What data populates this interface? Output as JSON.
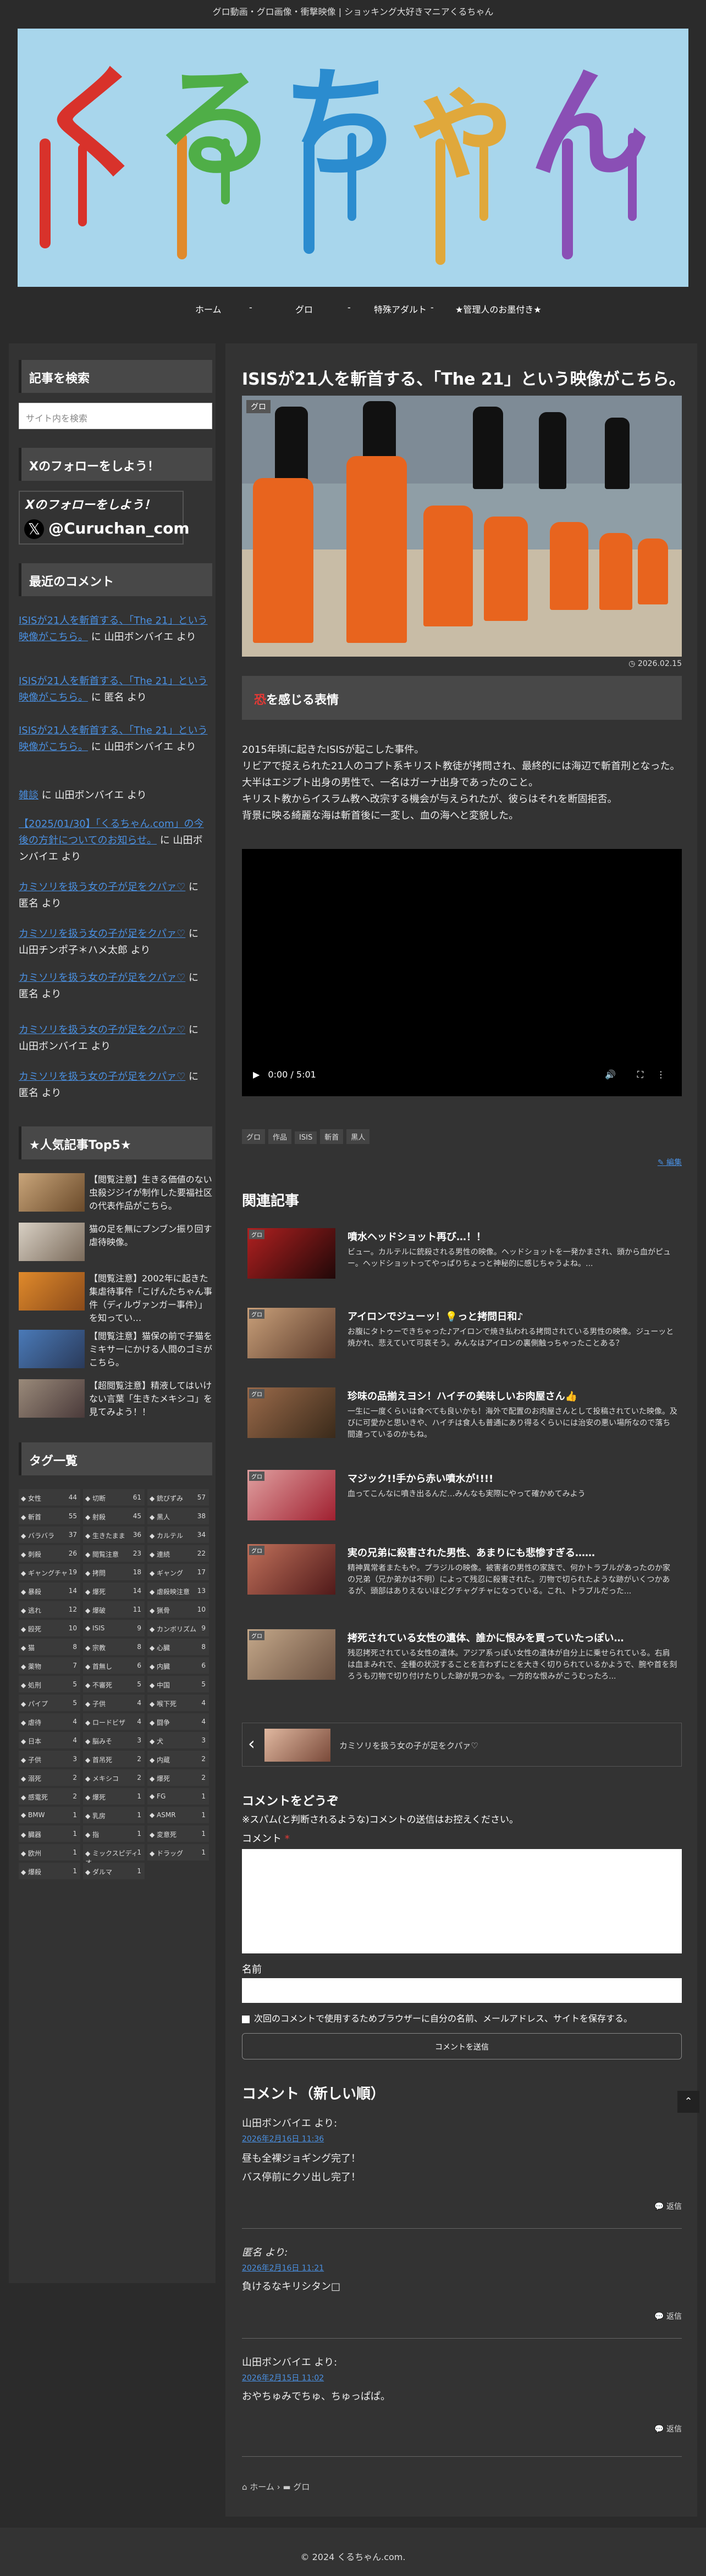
{
  "header": {
    "tagline": "グロ動画・グロ画像・衝撃映像 | ショッキング大好きマニアくるちゃん",
    "logo_text": "くるちゃん"
  },
  "nav": {
    "items": [
      "ホーム",
      "グロ",
      "特殊アダルト",
      "★管理人のお墨付き★"
    ],
    "separator": "-"
  },
  "sidebar": {
    "search_title": "記事を検索",
    "search_placeholder": "サイト内を検索",
    "follow_title": "Xのフォローをしよう！",
    "follow_banner_line1": "Xのフォローをしよう！",
    "follow_banner_handle": "@Curuchan_com",
    "recent_title": "最近のコメント",
    "recent_comments": [
      {
        "link": "ISISが21人を斬首する、「The 21」という映像がこちら。",
        "text": " に 山田ボンバイエ より"
      },
      {
        "link": "ISISが21人を斬首する、「The 21」という映像がこちら。",
        "text": " に 匿名 より"
      },
      {
        "link": "ISISが21人を斬首する、「The 21」という映像がこちら。",
        "text": " に 山田ボンバイエ より"
      },
      {
        "link": "雑談",
        "text": " に 山田ボンバイエ より"
      },
      {
        "link": "【2025/01/30】「くるちゃん.com」の今後の方針についてのお知らせ。",
        "text": " に 山田ボンバイエ より"
      },
      {
        "link": "カミソリを扱う女の子が足をクパァ♡",
        "text": " に 匿名 より"
      },
      {
        "link": "カミソリを扱う女の子が足をクパァ♡",
        "text": " に 山田チンポ子＊ハメ太郎 より"
      },
      {
        "link": "カミソリを扱う女の子が足をクパァ♡",
        "text": " に 匿名 より"
      },
      {
        "link": "カミソリを扱う女の子が足をクパァ♡",
        "text": " に 山田ボンバイエ より"
      },
      {
        "link": "カミソリを扱う女の子が足をクパァ♡",
        "text": " に 匿名 より"
      }
    ],
    "popular_title": "★人気記事Top5★",
    "popular": [
      "【閲覧注意】生きる価値のない虫殺ジジイが制作した要福社区の代表作品がこちら。",
      "猫の足を無にブンブン振り回す虐待映像。",
      "【閲覧注意】2002年に起きた集虐待事件「こげんたちゃん事件（ディルヴァンガー事件）」を知ってい…",
      "【閲覧注意】猫保の前で子猫をミキサーにかける人間のゴミがこちら。",
      "【超閲覧注意】精液してはいけない言葉「生きたメキシコ」を見てみよう！！"
    ],
    "tags_title": "タグ一覧",
    "tags": [
      [
        "女性",
        "44"
      ],
      [
        "切断",
        "61"
      ],
      [
        "銃びずみ",
        "57"
      ],
      [
        "斬首",
        "55"
      ],
      [
        "射殺",
        "45"
      ],
      [
        "黒人",
        "38"
      ],
      [
        "バラバラ",
        "37"
      ],
      [
        "生きたまま",
        "36"
      ],
      [
        "カルテル",
        "34"
      ],
      [
        "刺殺",
        "26"
      ],
      [
        "閲覧注意",
        "23"
      ],
      [
        "連続",
        "22"
      ],
      [
        "ギャングチャ",
        "19"
      ],
      [
        "拷問",
        "18"
      ],
      [
        "ギャング",
        "17"
      ],
      [
        "暴殺",
        "14"
      ],
      [
        "爆死",
        "14"
      ],
      [
        "虐殺映注意",
        "13"
      ],
      [
        "逃れ",
        "12"
      ],
      [
        "爆破",
        "11"
      ],
      [
        "猟骨",
        "10"
      ],
      [
        "殴死",
        "10"
      ],
      [
        "ISIS",
        "9"
      ],
      [
        "カンボリズム",
        "9"
      ],
      [
        "猫",
        "8"
      ],
      [
        "宗教",
        "8"
      ],
      [
        "心臓",
        "8"
      ],
      [
        "薬物",
        "7"
      ],
      [
        "首無し",
        "6"
      ],
      [
        "内臓",
        "6"
      ],
      [
        "処刑",
        "5"
      ],
      [
        "不審死",
        "5"
      ],
      [
        "中国",
        "5"
      ],
      [
        "パイプ",
        "5"
      ],
      [
        "子供",
        "4"
      ],
      [
        "喉下死",
        "4"
      ],
      [
        "虐待",
        "4"
      ],
      [
        "ロードビザ",
        "4"
      ],
      [
        "闘争",
        "4"
      ],
      [
        "日本",
        "4"
      ],
      [
        "脳みそ",
        "3"
      ],
      [
        "犬",
        "3"
      ],
      [
        "子供",
        "3"
      ],
      [
        "首吊死",
        "2"
      ],
      [
        "内蔵",
        "2"
      ],
      [
        "溺死",
        "2"
      ],
      [
        "メキシコ",
        "2"
      ],
      [
        "爆死",
        "2"
      ],
      [
        "感電死",
        "2"
      ],
      [
        "爆死",
        "1"
      ],
      [
        "FG",
        "1"
      ],
      [
        "BMW",
        "1"
      ],
      [
        "乳房",
        "1"
      ],
      [
        "ASMR",
        "1"
      ],
      [
        "臓器",
        "1"
      ],
      [
        "指",
        "1"
      ],
      [
        "変意死",
        "1"
      ],
      [
        "欧州",
        "1"
      ],
      [
        "ミックスピディオ",
        "1"
      ],
      [
        "ドラッグ",
        "1"
      ],
      [
        "爆殺",
        "1"
      ],
      [
        "ダルマ",
        "1"
      ]
    ]
  },
  "post": {
    "title": "ISISが21人を斬首する、「The 21」という映像がこちら。",
    "category_badge": "グロ",
    "date": "2026.02.15",
    "box_heading_mark": "恐",
    "box_heading": "を感じる表情",
    "paragraphs": [
      "2015年頃に起きたISISが起こした事件。",
      "リビアで捉えられた21人のコプト系キリスト教徒が拷問され、最終的には海辺で斬首刑となった。",
      "大半はエジプト出身の男性で、一名はガーナ出身であったのこと。",
      "キリスト教からイスラム教へ改宗する機会が与えられたが、彼らはそれを断固拒否。",
      "背景に映る綺麗な海は斬首後に一変し、血の海へと変貌した。"
    ],
    "video_time": "0:00 / 5:01",
    "tags": [
      "グロ",
      "作品",
      "ISIS",
      "斬首",
      "黒人"
    ],
    "edit_label": "編集"
  },
  "related": {
    "title": "関連記事",
    "items": [
      {
        "cat": "グロ",
        "title": "噴水ヘッドショット再び…！！",
        "desc": "ビュー。カルテルに銃殺される男性の映像。ヘッドショットを一発かまされ、頭から血がピュー。ヘッドショットってやっぱりちょっと神秘的に感じちゃうよね。..."
      },
      {
        "cat": "グロ",
        "title": "アイロンでジューッ！💡っと拷問日和♪",
        "desc": "お腹にタトゥーできちゃった♪アイロンで焼き払われる拷問されている男性の映像。ジューッと焼かれ、悲えていて可哀そう。みんなはアイロンの裏側触っちゃったことある？"
      },
      {
        "cat": "グロ",
        "title": "珍味の品揃えヨシ！ハイチの美味しいお肉屋さん👍",
        "desc": "一生に一度くらいは食べても良いかも！海外で配置のお肉屋さんとして投稿されていた映像。及びに可愛かと思いきや、ハイチは食人も普通にあり得るくらいには治安の悪い場所なので落ち間違っているのかもね。"
      },
      {
        "cat": "グロ",
        "title": "マジック!!手から赤い噴水が!!!!",
        "desc": "血ってこんなに噴き出るんだ…みんなも実際にやって確かめてみよう"
      },
      {
        "cat": "グロ",
        "title": "実の兄弟に殺害された男性、あまりにも悲惨すぎる……",
        "desc": "精神異常者またもや。プラジルの映像。被害者の男性の家族で、何かトラブルがあったのか家の兄弟（兄か弟かは不明）によって残忍に殺害された。刃物で切られたような跡がいくつかあるが、頭部はありえないほどグチャグチャになっている。これ、トラブルだった..."
      },
      {
        "cat": "グロ",
        "title": "拷死されている女性の遺体、誰かに恨みを買っていたっぽい…",
        "desc": "残忍拷死されている女性の遺体。アジア系っぽい女性の遺体が自分上に乗せられている。右肩は血まみれで、全種の状況することを言わずにとを大きく切りられているかようで、腕や首を刻ろうも刃物で切り付けたりした跡が見つかる。一方的な恨みがこうむったろ..."
      }
    ]
  },
  "prev_post": "カミソリを扱う女の子が足をクパァ♡",
  "comment_form": {
    "title": "コメントをどうぞ",
    "note": "※スパム(と判断されるような)コメントの送信はお控えください。",
    "comment_label": "コメント",
    "required_mark": "*",
    "name_label": "名前",
    "save_label": "次回のコメントで使用するためブラウザーに自分の名前、メールアドレス、サイトを保存する。",
    "submit_label": "コメントを送信"
  },
  "comments": {
    "title": "コメント（新しい順）",
    "reply_label": "返信",
    "items": [
      {
        "author": "山田ボンバイエ より:",
        "date": "2026年2月16日 11:36",
        "lines": [
          "昼も全裸ジョギング完了！",
          "バス停前にクソ出し完了！"
        ]
      },
      {
        "author": "匿名 より:",
        "date": "2026年2月16日 11:21",
        "lines": [
          "負けるなキリシタン□"
        ]
      },
      {
        "author": "山田ボンバイエ より:",
        "date": "2026年2月15日 11:02",
        "lines": [
          "おやちゅみでちゅ、ちゅっぱぱ。"
        ]
      }
    ]
  },
  "breadcrumb": [
    "ホーム",
    "グロ"
  ],
  "footer": "© 2024 くるちゃん.com.",
  "colors": {
    "bg": "#2b2b2b",
    "panel": "#333333",
    "link": "#4a90e2",
    "accent_red": "#e53935",
    "orange": "#e8641e"
  }
}
